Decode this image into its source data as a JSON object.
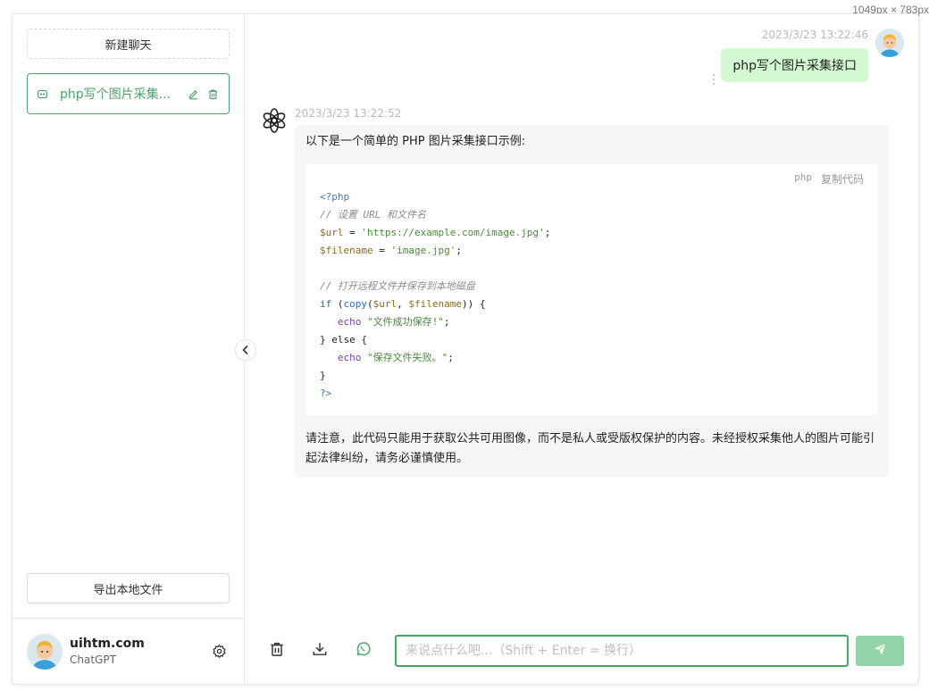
{
  "page": {
    "size_label": "1049px × 783px"
  },
  "sidebar": {
    "new_chat_label": "新建聊天",
    "chats": [
      {
        "title": "php写个图片采集..."
      }
    ],
    "export_label": "导出本地文件",
    "user": {
      "name": "uihtm.com",
      "sub": "ChatGPT"
    }
  },
  "conversation": {
    "user_message": {
      "timestamp": "2023/3/23 13:22:46",
      "text": "php写个图片采集接口"
    },
    "bot_message": {
      "timestamp": "2023/3/23 13:22:52",
      "intro": "以下是一个简单的 PHP 图片采集接口示例:",
      "code": {
        "lang": "php",
        "copy_label": "复制代码",
        "lines": {
          "l1": "<?php",
          "l2": "// 设置 URL 和文件名",
          "l3_var": "$url",
          "l3_str": "'https://example.com/image.jpg'",
          "l4_var": "$filename",
          "l4_str": "'image.jpg'",
          "l6": "// 打开远程文件并保存到本地磁盘",
          "l7_kw": "if",
          "l7_fn": "copy",
          "l7_a": "$url",
          "l7_b": "$filename",
          "l8_kw": "echo",
          "l8_str": "\"文件成功保存!\"",
          "l9": "} else {",
          "l10_kw": "echo",
          "l10_str": "\"保存文件失败。\"",
          "l11": "}",
          "l12": "?>"
        }
      },
      "note": "请注意，此代码只能用于获取公共可用图像，而不是私人或受版权保护的内容。未经授权采集他人的图片可能引起法律纠纷，请务必谨慎使用。"
    }
  },
  "input": {
    "placeholder": "来说点什么吧...（Shift + Enter = 换行）"
  },
  "colors": {
    "accent": "#4ba36a",
    "user_bubble": "#d2f9d1",
    "bot_bubble": "#f4f6f8",
    "send_button": "#92d4a8"
  },
  "icons": {
    "chat": "chat-bubble-icon",
    "edit": "pencil-icon",
    "delete": "trash-icon",
    "settings": "gear-icon",
    "collapse": "chevron-left-icon",
    "bot": "openai-logo-icon",
    "clear": "trash-icon",
    "download": "download-icon",
    "whatsapp": "whatsapp-icon",
    "send": "paper-plane-icon"
  }
}
